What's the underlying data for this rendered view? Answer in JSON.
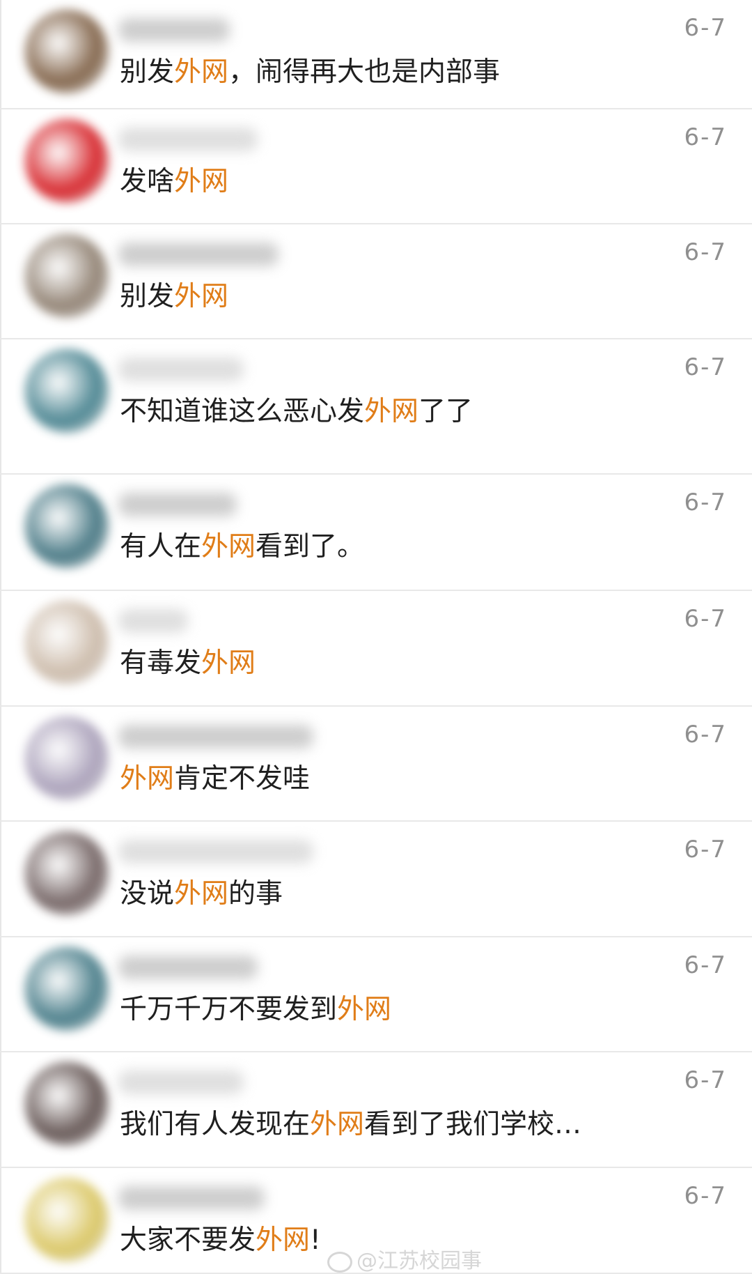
{
  "comments": [
    {
      "date": "6-7",
      "parts": [
        {
          "t": "别发"
        },
        {
          "t": "外网",
          "hl": true
        },
        {
          "t": "，闹得再大也是内部事"
        }
      ],
      "avatar": "#7a5a3e"
    },
    {
      "date": "6-7",
      "parts": [
        {
          "t": "发啥"
        },
        {
          "t": "外网",
          "hl": true
        }
      ],
      "avatar": "#d4161c"
    },
    {
      "date": "6-7",
      "parts": [
        {
          "t": "别发"
        },
        {
          "t": "外网",
          "hl": true
        }
      ],
      "avatar": "#8a7a6a"
    },
    {
      "date": "6-7",
      "parts": [
        {
          "t": "不知道谁这么恶心发"
        },
        {
          "t": "外网",
          "hl": true
        },
        {
          "t": "了了"
        }
      ],
      "avatar": "#3f7d8a"
    },
    {
      "date": "6-7",
      "parts": [
        {
          "t": "有人在"
        },
        {
          "t": "外网",
          "hl": true
        },
        {
          "t": "看到了。"
        }
      ],
      "avatar": "#3b6f7c"
    },
    {
      "date": "6-7",
      "parts": [
        {
          "t": "有毒发"
        },
        {
          "t": "外网",
          "hl": true
        }
      ],
      "avatar": "#c9b7a5"
    },
    {
      "date": "6-7",
      "parts": [
        {
          "t": "外网",
          "hl": true
        },
        {
          "t": "肯定不发哇"
        }
      ],
      "avatar": "#a49ab5"
    },
    {
      "date": "6-7",
      "parts": [
        {
          "t": "没说"
        },
        {
          "t": "外网",
          "hl": true
        },
        {
          "t": "的事"
        }
      ],
      "avatar": "#6b5a5a"
    },
    {
      "date": "6-7",
      "parts": [
        {
          "t": "千万千万不要发到"
        },
        {
          "t": "外网",
          "hl": true
        }
      ],
      "avatar": "#3c7481"
    },
    {
      "date": "6-7",
      "parts": [
        {
          "t": "我们有人发现在"
        },
        {
          "t": "外网",
          "hl": true
        },
        {
          "t": "看到了我们学校…"
        }
      ],
      "avatar": "#5a4a48"
    },
    {
      "date": "6-7",
      "parts": [
        {
          "t": "大家不要发"
        },
        {
          "t": "外网",
          "hl": true
        },
        {
          "t": "!"
        }
      ],
      "avatar": "#d8c35a"
    }
  ],
  "watermark": "@江苏校园事",
  "colors": {
    "highlight": "#e07d18",
    "date": "#8f8f8f",
    "text": "#1f1f1f"
  }
}
